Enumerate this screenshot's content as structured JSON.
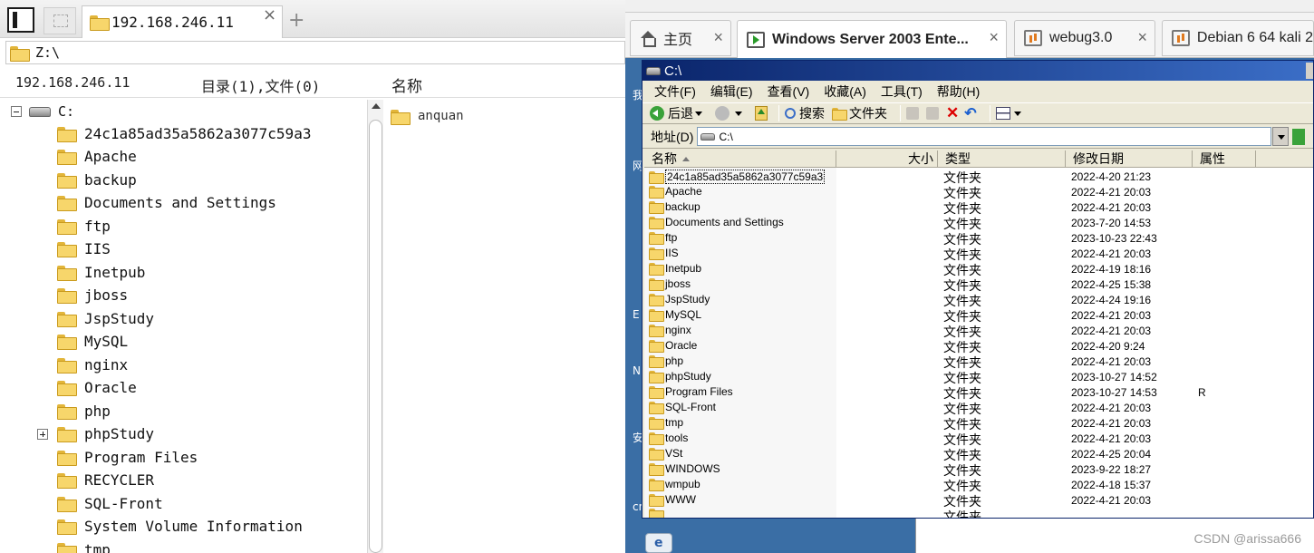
{
  "left_app": {
    "tab_title": "192.168.246.11",
    "tab_close": "×",
    "new_tab": "+",
    "address": "Z:\\",
    "host_label": "192.168.246.11",
    "summary": "目录(1),文件(0)",
    "name_header": "名称",
    "tree_root": "C:",
    "tree_items": [
      "24c1a85ad35a5862a3077c59a3",
      "Apache",
      "backup",
      "Documents and Settings",
      "ftp",
      "IIS",
      "Inetpub",
      "jboss",
      "JspStudy",
      "MySQL",
      "nginx",
      "Oracle",
      "php",
      "phpStudy",
      "Program Files",
      "RECYCLER",
      "SQL-Front",
      "System Volume Information",
      "tmp"
    ],
    "list_items": [
      "anquan"
    ]
  },
  "vm": {
    "tabs": [
      {
        "label": "主页",
        "icon": "home-icon"
      },
      {
        "label": "Windows Server 2003 Ente...",
        "icon": "vm-icon",
        "active": true
      },
      {
        "label": "webug3.0",
        "icon": "vm-icon"
      },
      {
        "label": "Debian 6 64 kali 2",
        "icon": "vm-icon"
      }
    ],
    "tab_close": "×",
    "desktop_chars": [
      "我",
      "网",
      "E",
      "N",
      "安",
      "cn"
    ],
    "ie_label": "e"
  },
  "explorer": {
    "title": "C:\\",
    "menu": [
      "文件(F)",
      "编辑(E)",
      "查看(V)",
      "收藏(A)",
      "工具(T)",
      "帮助(H)"
    ],
    "toolbar": {
      "back": "后退",
      "search": "搜索",
      "folders": "文件夹"
    },
    "address_label": "地址(D)",
    "address_value": "C:\\",
    "columns": [
      "名称",
      "大小",
      "类型",
      "修改日期",
      "属性"
    ],
    "rows": [
      {
        "name": "24c1a85ad35a5862a3077c59a3",
        "type": "文件夹",
        "date": "2022-4-20 21:23",
        "attr": ""
      },
      {
        "name": "Apache",
        "type": "文件夹",
        "date": "2022-4-21 20:03",
        "attr": ""
      },
      {
        "name": "backup",
        "type": "文件夹",
        "date": "2022-4-21 20:03",
        "attr": ""
      },
      {
        "name": "Documents and Settings",
        "type": "文件夹",
        "date": "2023-7-20 14:53",
        "attr": ""
      },
      {
        "name": "ftp",
        "type": "文件夹",
        "date": "2023-10-23 22:43",
        "attr": ""
      },
      {
        "name": "IIS",
        "type": "文件夹",
        "date": "2022-4-21 20:03",
        "attr": ""
      },
      {
        "name": "Inetpub",
        "type": "文件夹",
        "date": "2022-4-19 18:16",
        "attr": ""
      },
      {
        "name": "jboss",
        "type": "文件夹",
        "date": "2022-4-25 15:38",
        "attr": ""
      },
      {
        "name": "JspStudy",
        "type": "文件夹",
        "date": "2022-4-24 19:16",
        "attr": ""
      },
      {
        "name": "MySQL",
        "type": "文件夹",
        "date": "2022-4-21 20:03",
        "attr": ""
      },
      {
        "name": "nginx",
        "type": "文件夹",
        "date": "2022-4-21 20:03",
        "attr": ""
      },
      {
        "name": "Oracle",
        "type": "文件夹",
        "date": "2022-4-20 9:24",
        "attr": ""
      },
      {
        "name": "php",
        "type": "文件夹",
        "date": "2022-4-21 20:03",
        "attr": ""
      },
      {
        "name": "phpStudy",
        "type": "文件夹",
        "date": "2023-10-27 14:52",
        "attr": ""
      },
      {
        "name": "Program Files",
        "type": "文件夹",
        "date": "2023-10-27 14:53",
        "attr": "R"
      },
      {
        "name": "SQL-Front",
        "type": "文件夹",
        "date": "2022-4-21 20:03",
        "attr": ""
      },
      {
        "name": "tmp",
        "type": "文件夹",
        "date": "2022-4-21 20:03",
        "attr": ""
      },
      {
        "name": "tools",
        "type": "文件夹",
        "date": "2022-4-21 20:03",
        "attr": ""
      },
      {
        "name": "VSt",
        "type": "文件夹",
        "date": "2022-4-25 20:04",
        "attr": ""
      },
      {
        "name": "WINDOWS",
        "type": "文件夹",
        "date": "2023-9-22 18:27",
        "attr": ""
      },
      {
        "name": "wmpub",
        "type": "文件夹",
        "date": "2022-4-18 15:37",
        "attr": ""
      },
      {
        "name": "WWW",
        "type": "文件夹",
        "date": "2022-4-21 20:03",
        "attr": ""
      },
      {
        "name": "",
        "type": "文件夹",
        "date": "",
        "attr": ""
      }
    ]
  },
  "watermark": "CSDN @arissa666"
}
